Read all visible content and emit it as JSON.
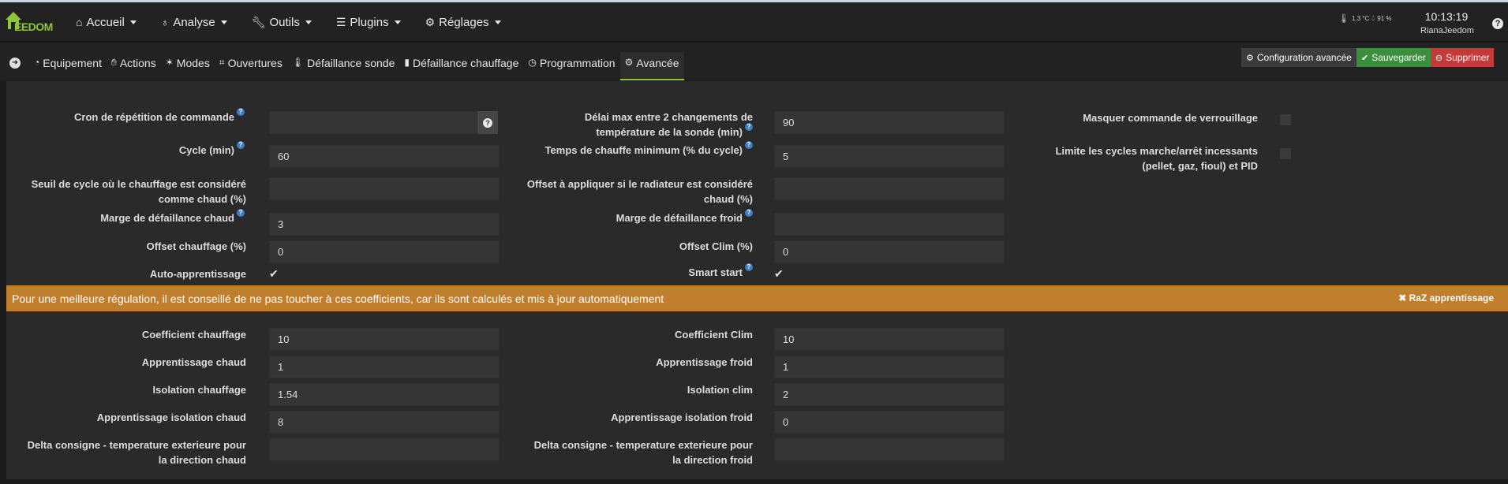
{
  "navbar": {
    "logo_text": "EEDOM",
    "menu": [
      {
        "label": "Accueil",
        "icon": "home-icon"
      },
      {
        "label": "Analyse",
        "icon": "stethoscope-icon"
      },
      {
        "label": "Outils",
        "icon": "wrench-icon"
      },
      {
        "label": "Plugins",
        "icon": "tasks-icon"
      },
      {
        "label": "Réglages",
        "icon": "cogs-icon"
      }
    ],
    "weather": {
      "temp": "1.3 °C",
      "humidity": "91 %"
    },
    "time": "10:13:19",
    "user": "RianaJeedom"
  },
  "tabs": [
    {
      "label": "Equipement",
      "icon": "tachometer-icon"
    },
    {
      "label": "Actions",
      "icon": "hand-icon"
    },
    {
      "label": "Modes",
      "icon": "magic-icon"
    },
    {
      "label": "Ouvertures",
      "icon": "window-icon"
    },
    {
      "label": "Défaillance sonde",
      "icon": "thermometer-icon"
    },
    {
      "label": "Défaillance chauffage",
      "icon": "battery-icon"
    },
    {
      "label": "Programmation",
      "icon": "clock-icon"
    },
    {
      "label": "Avancée",
      "icon": "cog-icon"
    }
  ],
  "buttons": {
    "config": "Configuration avancée",
    "save": "Sauvegarder",
    "delete": "Supprimer"
  },
  "form": {
    "cron_label": "Cron de répétition de commande",
    "cron_value": "",
    "delai_label_1": "Délai max entre 2 changements de",
    "delai_label_2": "température de la sonde (min)",
    "delai_value": "90",
    "masquer_label": "Masquer commande de verrouillage",
    "cycle_label": "Cycle (min)",
    "cycle_value": "60",
    "temps_label": "Temps de chauffe minimum (% du cycle)",
    "temps_value": "5",
    "limite_label_1": "Limite les cycles marche/arrêt incessants",
    "limite_label_2": "(pellet, gaz, fioul) et PID",
    "seuil_label_1": "Seuil de cycle où le chauffage est considéré",
    "seuil_label_2": "comme chaud (%)",
    "seuil_value": "",
    "offset_rad_label_1": "Offset à appliquer si le radiateur est considéré",
    "offset_rad_label_2": "chaud (%)",
    "offset_rad_value": "",
    "marge_chaud_label": "Marge de défaillance chaud",
    "marge_chaud_value": "3",
    "marge_froid_label": "Marge de défaillance froid",
    "marge_froid_value": "",
    "offset_chauffage_label": "Offset chauffage (%)",
    "offset_chauffage_value": "0",
    "offset_clim_label": "Offset Clim (%)",
    "offset_clim_value": "0",
    "auto_label": "Auto-apprentissage",
    "smart_label": "Smart start"
  },
  "alert": {
    "text": "Pour une meilleure régulation, il est conseillé de ne pas toucher à ces coefficients, car ils sont calculés et mis à jour automatiquement",
    "reset": "RaZ apprentissage"
  },
  "coeffs": {
    "coef_chauffage_label": "Coefficient chauffage",
    "coef_chauffage_value": "10",
    "coef_clim_label": "Coefficient Clim",
    "coef_clim_value": "10",
    "appr_chaud_label": "Apprentissage chaud",
    "appr_chaud_value": "1",
    "appr_froid_label": "Apprentissage froid",
    "appr_froid_value": "1",
    "iso_chauffage_label": "Isolation chauffage",
    "iso_chauffage_value": "1.54",
    "iso_clim_label": "Isolation clim",
    "iso_clim_value": "2",
    "appr_iso_chaud_label": "Apprentissage isolation chaud",
    "appr_iso_chaud_value": "8",
    "appr_iso_froid_label": "Apprentissage isolation froid",
    "appr_iso_froid_value": "0",
    "delta_chaud_label_1": "Delta consigne - temperature exterieure pour",
    "delta_chaud_label_2": "la direction chaud",
    "delta_chaud_value": "",
    "delta_froid_label_1": "Delta consigne - temperature exterieure pour",
    "delta_froid_label_2": "la direction froid",
    "delta_froid_value": ""
  }
}
